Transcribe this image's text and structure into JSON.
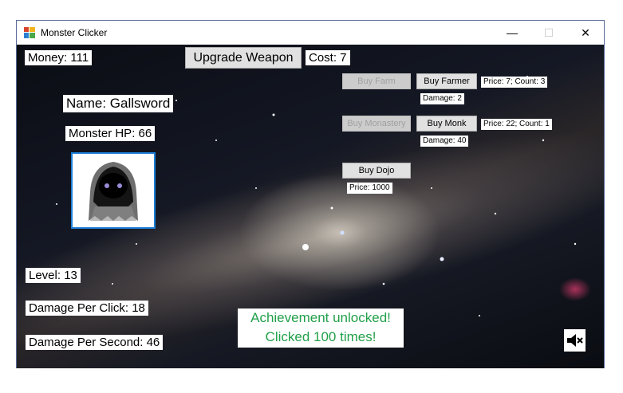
{
  "window": {
    "title": "Monster Clicker"
  },
  "titlebar": {
    "minimize": "—",
    "maximize": "☐",
    "close": "✕"
  },
  "stats": {
    "money": "Money: 111",
    "name": "Name: Gallsword",
    "monster_hp": "Monster HP: 66",
    "level": "Level: 13",
    "damage_per_click": "Damage Per Click: 18",
    "damage_per_second": "Damage Per Second: 46"
  },
  "upgrade": {
    "button": "Upgrade Weapon",
    "cost": "Cost: 7"
  },
  "shop": {
    "farm": {
      "button": "Buy Farm"
    },
    "farmer": {
      "button": "Buy Farmer",
      "info": "Price: 7; Count: 3",
      "damage": "Damage: 2"
    },
    "monastery": {
      "button": "Buy Monastery"
    },
    "monk": {
      "button": "Buy Monk",
      "info": "Price: 22; Count: 1",
      "damage": "Damage: 40"
    },
    "dojo": {
      "button": "Buy Dojo",
      "price": "Price: 1000"
    }
  },
  "achievement": {
    "line1": "Achievement unlocked!",
    "line2": "Clicked 100 times!"
  },
  "icons": {
    "mute": "speaker-muted-icon",
    "monster": "hooded-ghost-monster"
  },
  "colors": {
    "achievement_text": "#22a04a",
    "monster_border": "#1e7fd8"
  }
}
